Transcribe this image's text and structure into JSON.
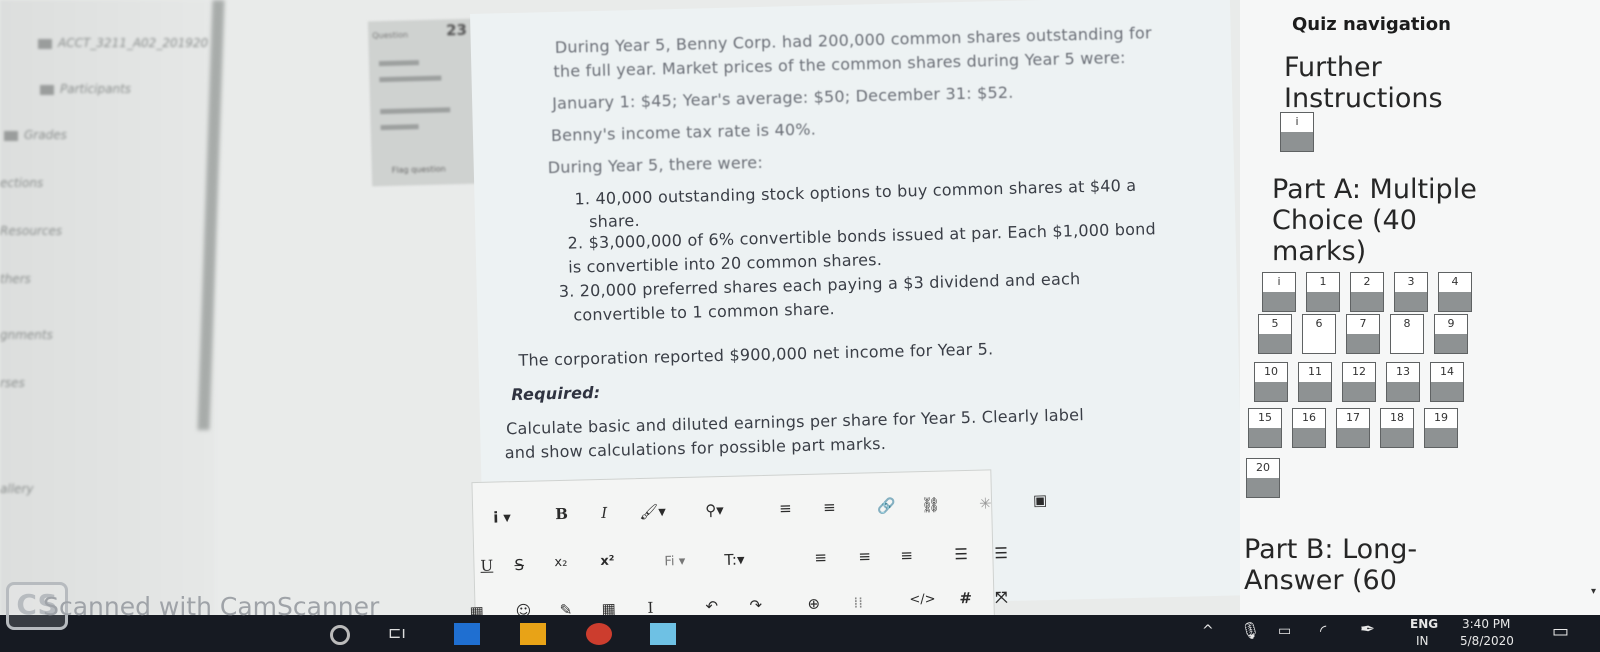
{
  "left_nav": {
    "items": [
      {
        "label": "ACCT_3211_A02_201920"
      },
      {
        "label": "Participants"
      },
      {
        "label": "Grades"
      },
      {
        "label": "ections"
      },
      {
        "label": "Resources"
      },
      {
        "label": "thers"
      },
      {
        "label": "gnments"
      },
      {
        "label": "rses"
      },
      {
        "label": "allery"
      }
    ]
  },
  "question_info": {
    "word": "Question",
    "number": "23",
    "flag_label": "Flag question"
  },
  "question": {
    "lines": [
      "During Year 5, Benny Corp. had 200,000 common shares outstanding for",
      "the full year. Market prices of the common shares during Year 5 were:",
      "January 1: $45; Year's average: $50; December 31: $52.",
      "Benny's income tax rate is 40%.",
      "During Year 5, there were:",
      "1. 40,000 outstanding stock options to buy common shares at $40 a",
      "share.",
      "2. $3,000,000 of 6% convertible bonds issued at par. Each $1,000 bond",
      "is convertible into 20 common shares.",
      "3. 20,000 preferred shares each paying a $3 dividend and each",
      "convertible to 1 common share.",
      "The corporation reported $900,000 net income for Year 5.",
      "Required:",
      "Calculate basic and diluted earnings per share for Year 5. Clearly label",
      "and show calculations for possible part marks."
    ]
  },
  "editor": {
    "row1": {
      "info": "i",
      "bold": "B",
      "italic": "I",
      "bullets": "≡",
      "numbered": "≡"
    },
    "row2": {
      "underline": "U",
      "strike": "S",
      "subscript": "x₂",
      "superscript": "x²",
      "font_family": "Fi",
      "font_size": "T:"
    },
    "row3": {
      "special": "I",
      "code": "</>",
      "hash": "#"
    }
  },
  "quiz_nav": {
    "title": "Quiz navigation",
    "further_line1": "Further",
    "further_line2": "Instructions",
    "further_box": "i",
    "part_a_line1": "Part A: Multiple",
    "part_a_line2": "Choice (40",
    "part_a_line3": "marks)",
    "boxes": [
      "i",
      "1",
      "2",
      "3",
      "4",
      "5",
      "6",
      "7",
      "8",
      "9",
      "10",
      "11",
      "12",
      "13",
      "14",
      "15",
      "16",
      "17",
      "18",
      "19",
      "20"
    ],
    "part_b_line1": "Part B: Long-",
    "part_b_line2": "Answer (60"
  },
  "taskbar": {
    "lang1": "ENG",
    "lang2": "IN",
    "time": "3:40 PM",
    "date": "5/8/2020"
  },
  "watermark": {
    "logo": "CS",
    "text": "Scanned with CamScanner"
  },
  "colors": {
    "nav_box_filled": "#8e9293",
    "taskbar": "#161a22",
    "content_bg": "#edf2f3"
  }
}
